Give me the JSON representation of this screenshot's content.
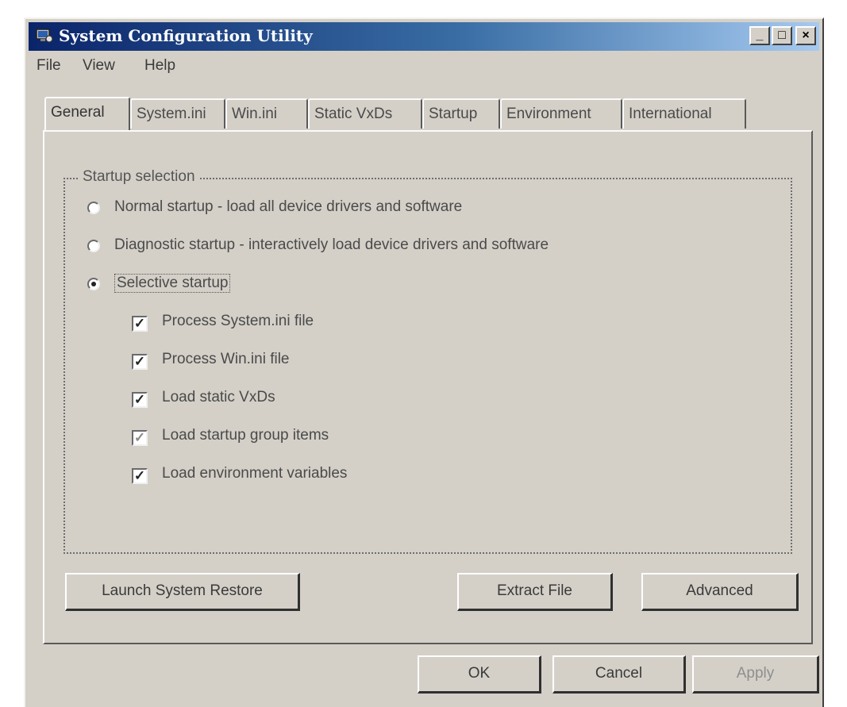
{
  "window": {
    "title": "System Configuration Utility",
    "controls": {
      "minimize": "_",
      "maximize": "□",
      "close": "×"
    }
  },
  "menu": [
    "File",
    "View",
    "Help"
  ],
  "tabs": [
    "General",
    "System.ini",
    "Win.ini",
    "Static VxDs",
    "Startup",
    "Environment",
    "International"
  ],
  "active_tab": "General",
  "startup_selection": {
    "label": "Startup selection",
    "options": [
      {
        "label": "Normal startup - load all device drivers and software",
        "selected": false
      },
      {
        "label": "Diagnostic startup - interactively load device drivers and software",
        "selected": false
      },
      {
        "label": "Selective startup",
        "selected": true
      }
    ],
    "checkboxes": [
      {
        "label": "Process System.ini file",
        "checked": true
      },
      {
        "label": "Process Win.ini file",
        "checked": true
      },
      {
        "label": "Load static VxDs",
        "checked": true
      },
      {
        "label": "Load startup group items",
        "checked": true,
        "dimmed": true
      },
      {
        "label": "Load environment variables",
        "checked": true
      }
    ]
  },
  "panel_buttons": {
    "launch_restore": "Launch System Restore",
    "extract_file": "Extract File",
    "advanced": "Advanced"
  },
  "dialog_buttons": {
    "ok": "OK",
    "cancel": "Cancel",
    "apply": "Apply"
  },
  "icons": {
    "app": "system-config-icon",
    "check_glyph": "✓"
  }
}
